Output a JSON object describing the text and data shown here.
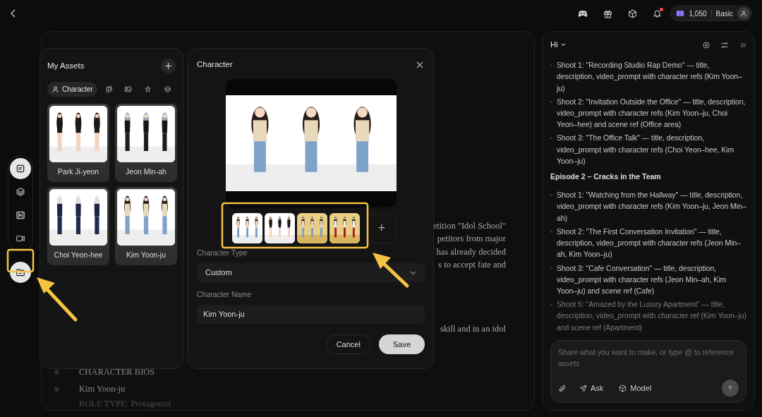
{
  "top_bar": {
    "notifications_unread": true,
    "credits": "1,050",
    "plan": "Basic"
  },
  "rail": [
    {
      "kind": "grouped",
      "selected": true
    },
    {
      "kind": "grouped",
      "selected": false
    },
    {
      "kind": "grouped",
      "selected": false
    },
    {
      "kind": "grouped",
      "selected": false
    },
    {
      "kind": "single",
      "selected": true
    }
  ],
  "assets": {
    "title": "My Assets",
    "filter_tabs": [
      {
        "label": "Character",
        "selected": true
      },
      {
        "selected": false
      },
      {
        "selected": false
      },
      {
        "selected": false
      },
      {
        "selected": false
      }
    ],
    "characters": [
      {
        "name": "Park Ji-yeon"
      },
      {
        "name": "Jeon Min-ah"
      },
      {
        "name": "Choi Yeon-hee"
      },
      {
        "name": "Kim Yoon-ju"
      }
    ]
  },
  "modal": {
    "title": "Character",
    "add_symbol": "+",
    "type_field": {
      "label": "Character Type",
      "value": "Custom"
    },
    "name_field": {
      "label": "Character Name",
      "value": "Kim Yoon-ju"
    },
    "buttons": [
      {
        "label": "Cancel",
        "kind": "secondary"
      },
      {
        "label": "Save",
        "kind": "primary"
      }
    ]
  },
  "document": {
    "paragraph_1": [
      "etition \"Idol School\"",
      "petitors from major",
      "has already decided",
      "s to accept fate and"
    ],
    "paragraph_2": [
      "skill and in an idol"
    ],
    "outline": [
      "CHARACTER BIOS",
      "Kim Yoon-ju"
    ],
    "role_line": "ROLE TYPE: Protagonist"
  },
  "chat": {
    "title": "Hi",
    "items": [
      {
        "kind": "bullet",
        "text": "Shoot 1: \"Recording Studio Rap Demo\" — title, description, video_prompt with character refs (Kim Yoon–ju)",
        "faded": false
      },
      {
        "kind": "bullet",
        "text": "Shoot 2: \"Invitation Outside the Office\" — title, description, video_prompt with character refs (Kim Yoon–ju, Choi Yeon–hee) and scene ref (Office area)",
        "faded": false
      },
      {
        "kind": "bullet",
        "text": "Shoot 3: \"The Office Talk\" — title, description, video_prompt with character refs (Choi Yeon–hee, Kim Yoon–ju)",
        "faded": false
      },
      {
        "kind": "heading",
        "text": "Episode 2 – Cracks in the Team",
        "faded": false
      },
      {
        "kind": "bullet",
        "text": "Shoot 1: \"Watching from the Hallway\" — title, description, video_prompt with character refs (Kim Yoon–ju, Jeon Min–ah)",
        "faded": false
      },
      {
        "kind": "bullet",
        "text": "Shoot 2: \"The First Conversation Invitation\" — title, description, video_prompt with character refs (Jeon Min–ah, Kim Yoon–ju)",
        "faded": false
      },
      {
        "kind": "bullet",
        "text": "Shoot 3: \"Cafe Conversation\" — title, description, video_prompt with character refs (Jeon Min–ah, Kim Yoon–ju) and scene ref (Cafe)",
        "faded": false
      },
      {
        "kind": "bullet",
        "text": "Shoot 5: \"Amazed by the Luxury Apartment\" — title, description, video_prompt with character ref (Kim Yoon–ju) and scene ref (Apartment)",
        "faded": true
      }
    ],
    "input": {
      "placeholder": "Share what you want to make, or type @ to reference assets",
      "actions": [
        "Ask",
        "Model"
      ]
    }
  }
}
